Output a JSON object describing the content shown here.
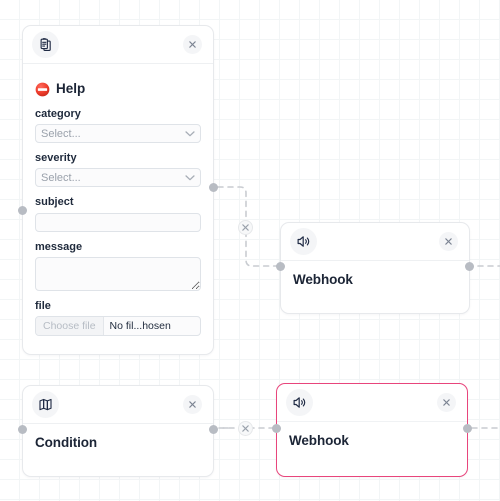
{
  "canvas": {
    "background_color": "#ffffff",
    "grid_color": "#f2f5f6",
    "grid_size": 20
  },
  "theme": {
    "card_border": "#e7e9ec",
    "selected_border": "#e8457c",
    "port_color": "#b8bcc3",
    "edge_color": "#c9ccd1",
    "text_color": "#1c2536",
    "muted_text": "#9aa1ab"
  },
  "nodes": [
    {
      "id": "form-node",
      "icon": "clipboard-icon",
      "close_label": "×",
      "title": "Help",
      "title_emoji": "no-entry-emoji",
      "selected": false,
      "fields": [
        {
          "name": "category",
          "label": "category",
          "type": "select",
          "value": "Select...",
          "placeholder": "Select..."
        },
        {
          "name": "severity",
          "label": "severity",
          "type": "select",
          "value": "Select...",
          "placeholder": "Select..."
        },
        {
          "name": "subject",
          "label": "subject",
          "type": "text",
          "value": "",
          "placeholder": ""
        },
        {
          "name": "message",
          "label": "message",
          "type": "textarea",
          "value": "",
          "placeholder": ""
        },
        {
          "name": "file",
          "label": "file",
          "type": "file",
          "button_label": "Choose file",
          "value": "No fil...hosen"
        }
      ]
    },
    {
      "id": "webhook-node-1",
      "icon": "speaker-icon",
      "close_label": "×",
      "title": "Webhook",
      "selected": false
    },
    {
      "id": "condition-node",
      "icon": "map-icon",
      "close_label": "×",
      "title": "Condition",
      "selected": false
    },
    {
      "id": "webhook-node-2",
      "icon": "speaker-icon",
      "close_label": "×",
      "title": "Webhook",
      "selected": true
    }
  ],
  "edges": [
    {
      "id": "edge-form-to-webhook",
      "delete_label": "×",
      "from": "form-node",
      "to": "webhook-node-1"
    },
    {
      "id": "edge-condition-to-webhook",
      "delete_label": "×",
      "from": "condition-node",
      "to": "webhook-node-2"
    }
  ]
}
